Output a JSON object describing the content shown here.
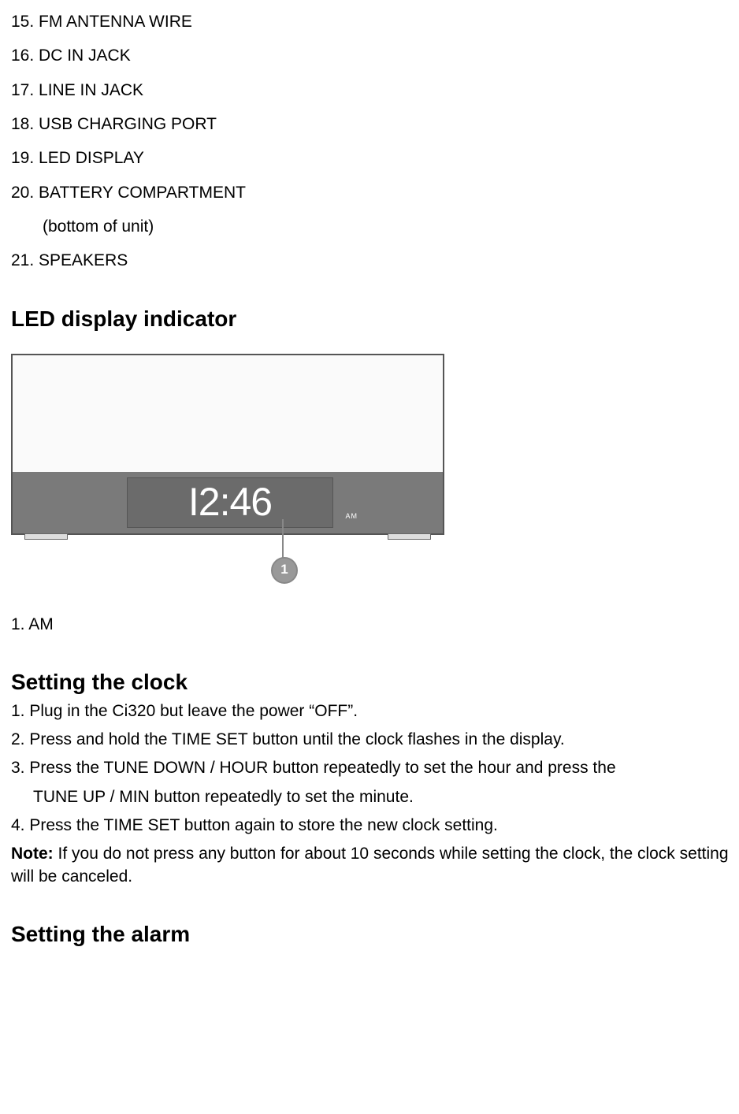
{
  "parts": {
    "p15": "15. FM ANTENNA WIRE",
    "p16": "16. DC IN JACK",
    "p17": "17. LINE IN JACK",
    "p18": "18. USB CHARGING PORT",
    "p19": "19. LED DISPLAY",
    "p20": "20. BATTERY COMPARTMENT",
    "p20sub": "(bottom of unit)",
    "p21": "21. SPEAKERS"
  },
  "led_section": {
    "heading": "LED display indicator",
    "clock_time": "I2:46",
    "am_label": "AM",
    "callout_number": "1",
    "indicator_1": "1.   AM"
  },
  "clock_section": {
    "heading": "Setting the clock",
    "step1": "1. Plug in the Ci320 but leave the power “OFF”.",
    "step2": "2. Press and hold the TIME SET button until the clock flashes in the display.",
    "step3": "3. Press the TUNE DOWN / HOUR button repeatedly to set the hour and press the",
    "step3b": "TUNE UP / MIN button repeatedly to set the minute.",
    "step4": "4. Press the TIME SET button again to store the new clock setting.",
    "note_label": "Note:",
    "note_text": " If you do not press any button for about 10 seconds while setting the clock, the clock setting will be canceled."
  },
  "alarm_section": {
    "heading": "Setting the alarm"
  }
}
